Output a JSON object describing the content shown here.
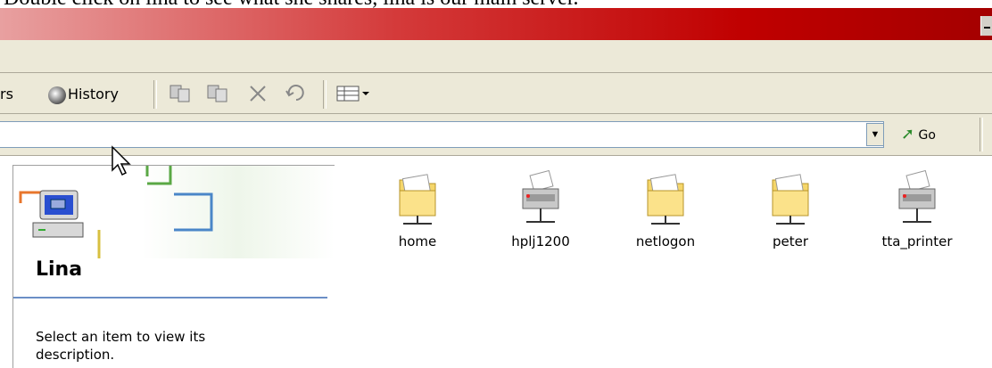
{
  "caption": "Double click on lina to see what she shares, lina is our main server.",
  "toolbar": {
    "folders_label": "rs",
    "history_label": "History"
  },
  "address": {
    "value": "",
    "go_label": "Go"
  },
  "left_pane": {
    "server_name": "Lina",
    "description": "Select an item to view its description."
  },
  "shares": [
    {
      "label": "home",
      "type": "folder"
    },
    {
      "label": "hplj1200",
      "type": "printer"
    },
    {
      "label": "netlogon",
      "type": "folder"
    },
    {
      "label": "peter",
      "type": "folder"
    },
    {
      "label": "tta_printer",
      "type": "printer"
    }
  ],
  "colors": {
    "titlebar": "#c00000",
    "chrome": "#ece9d8",
    "accent_rule": "#6b8fc6"
  }
}
